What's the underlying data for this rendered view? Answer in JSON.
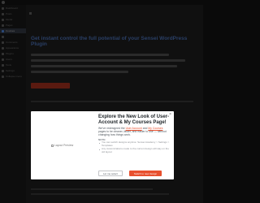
{
  "sidebar": {
    "items": [
      {
        "label": "Dashboard",
        "active": false
      },
      {
        "label": "Posts",
        "active": false
      },
      {
        "label": "Media",
        "active": false
      },
      {
        "label": "Pages",
        "active": false
      },
      {
        "label": "Courses",
        "active": true
      },
      {
        "label": "",
        "active": false
      },
      {
        "label": "Comments",
        "active": false
      },
      {
        "label": "Appearance",
        "active": false
      },
      {
        "label": "Plugins",
        "active": false
      },
      {
        "label": "Users",
        "active": false
      },
      {
        "label": "Tools",
        "active": false
      },
      {
        "label": "Settings",
        "active": false
      },
      {
        "label": "Collapse menu",
        "active": false
      }
    ]
  },
  "main": {
    "heading": "Get instant control the full potential of your Sensei WordPress Plugin",
    "cta_label": ""
  },
  "modal": {
    "image_alt": "Layout Preview",
    "title": "Explore the New Look of User-Account & My Courses Page!",
    "body_before": "We've redesigned the ",
    "link1": "User Account",
    "body_mid": " and ",
    "link2": "My Courses",
    "body_after": " pages to be cleaner, faster, and easier to use — without changing how things work.",
    "note_title": "NOTE:",
    "notes": [
      "You can switch designs anytime: Sensei Academy > Settings > Templates",
      "Any customizations made to the current design will stay on the old layout"
    ],
    "secondary_button": "Let me select",
    "primary_button": "Switch to new design",
    "close_glyph": "×"
  },
  "colors": {
    "accent": "#e8502e",
    "modal_bg": "#ffffff",
    "backdrop": "#0a0a0a"
  }
}
